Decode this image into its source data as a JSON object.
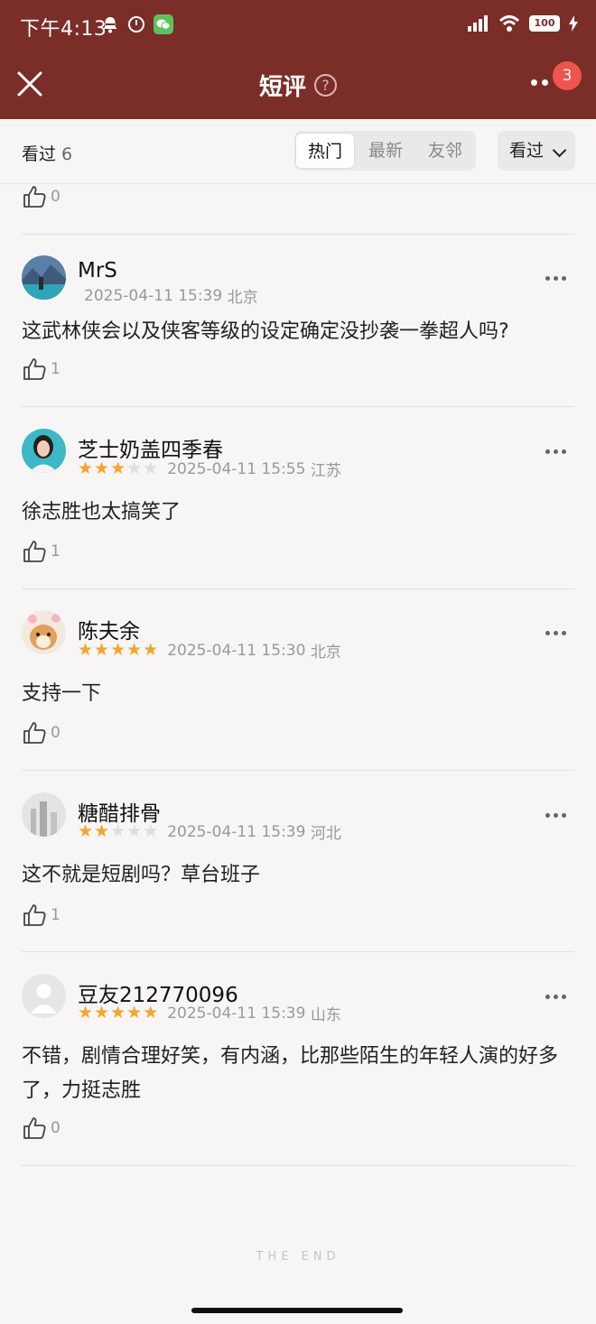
{
  "status_bar": {
    "time": "下午4:13",
    "battery": "100",
    "icons": [
      "notification-muted-icon",
      "alarm-clock-icon",
      "wechat-icon",
      "signal-icon",
      "wifi-icon",
      "battery-icon",
      "charging-icon"
    ]
  },
  "nav": {
    "title": "短评",
    "help_icon": "question-circle-icon",
    "badge_count": "3",
    "accent_color": "#7b2d28"
  },
  "filter": {
    "seen_label": "看过",
    "seen_count": "6",
    "tabs": [
      {
        "label": "热门",
        "active": true
      },
      {
        "label": "最新",
        "active": false
      },
      {
        "label": "友邻",
        "active": false
      }
    ],
    "sort_label": "看过"
  },
  "top_partial": {
    "likes": "0"
  },
  "comments": [
    {
      "user": "MrS",
      "rating": 0,
      "time": "2025-04-11 15:39",
      "location": "北京",
      "text": "这武林侠会以及侠客等级的设定确定没抄袭一拳超人吗?",
      "likes": "1"
    },
    {
      "user": "芝士奶盖四季春",
      "rating": 3,
      "time": "2025-04-11 15:55",
      "location": "江苏",
      "text": "徐志胜也太搞笑了",
      "likes": "1"
    },
    {
      "user": "陈夫余",
      "rating": 5,
      "time": "2025-04-11 15:30",
      "location": "北京",
      "text": "支持一下",
      "likes": "0"
    },
    {
      "user": "糖醋排骨",
      "rating": 2,
      "time": "2025-04-11 15:39",
      "location": "河北",
      "text": "这不就是短剧吗？草台班子",
      "likes": "1"
    },
    {
      "user": "豆友212770096",
      "rating": 5,
      "time": "2025-04-11 15:39",
      "location": "山东",
      "text": "不错，剧情合理好笑，有内涵，比那些陌生的年轻人演的好多了，力挺志胜",
      "likes": "0"
    }
  ],
  "footer": {
    "end_text": "THE END"
  }
}
